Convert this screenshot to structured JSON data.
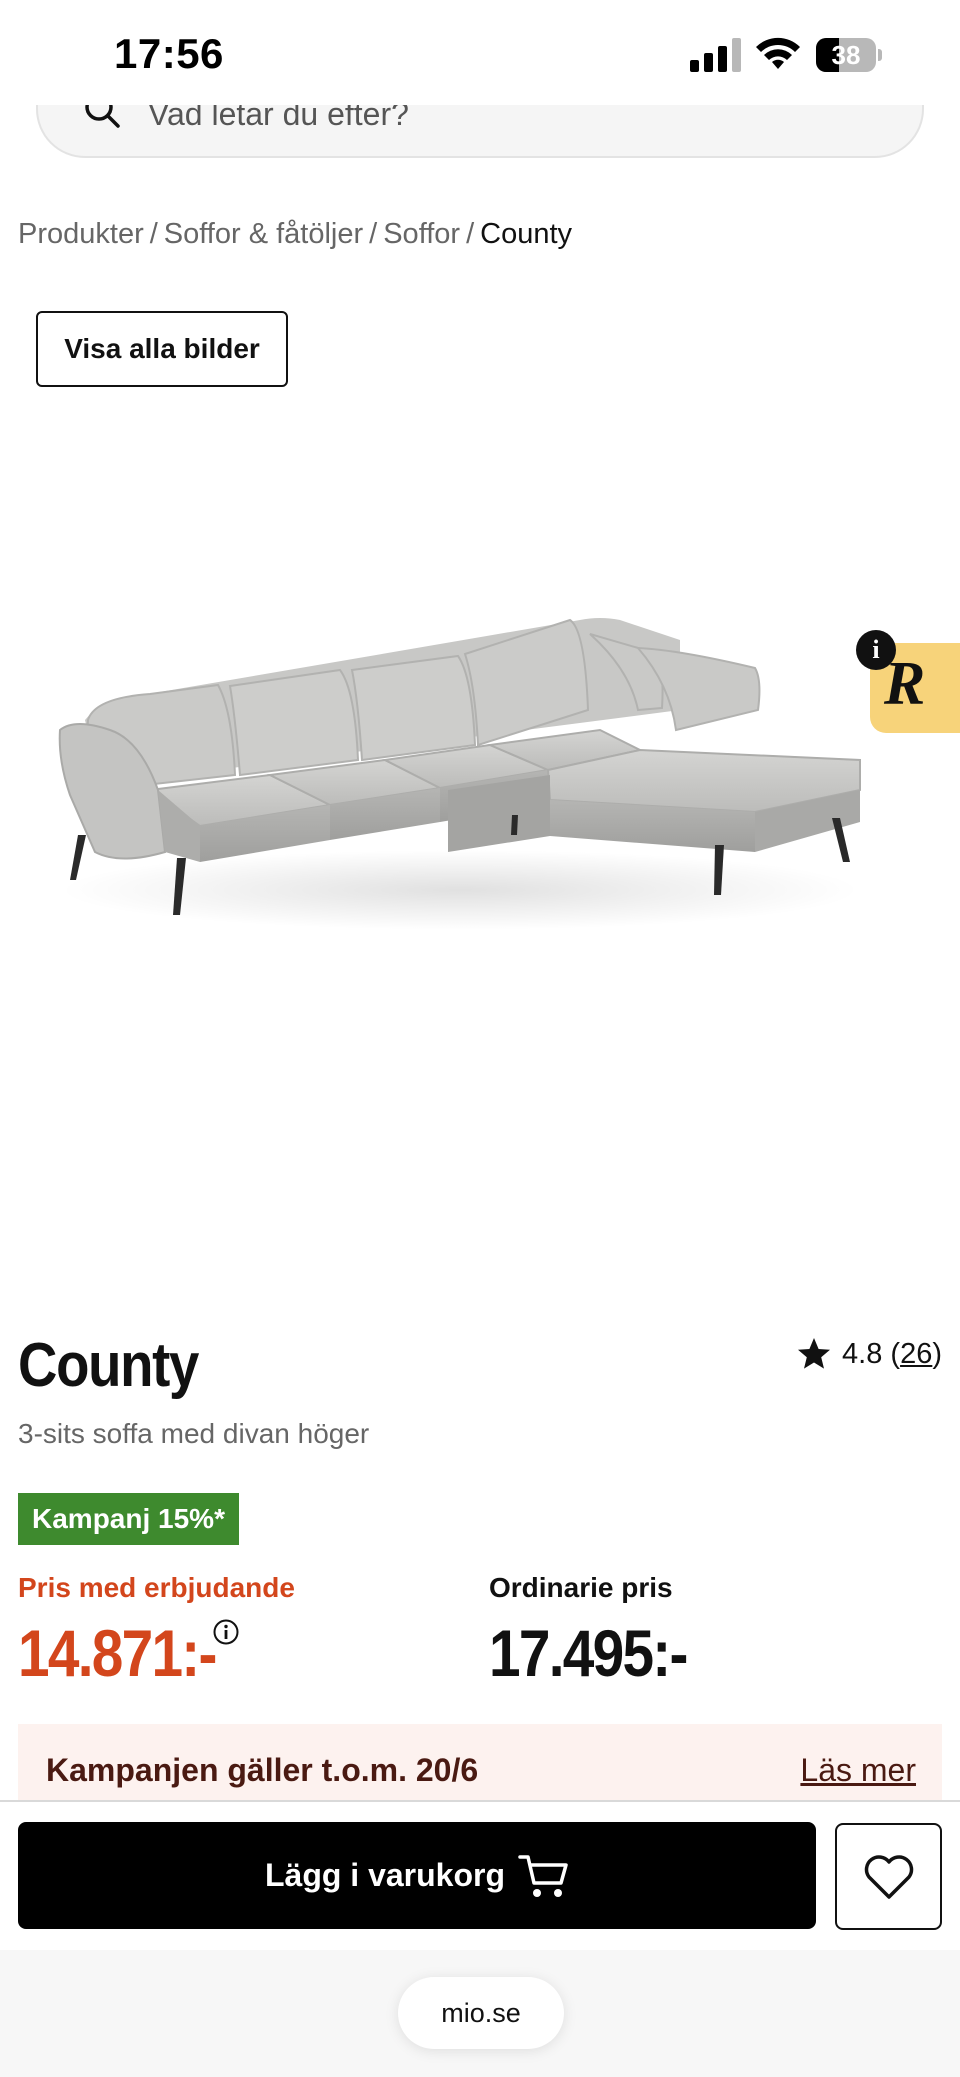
{
  "status_bar": {
    "time": "17:56",
    "battery_percent": 38,
    "battery_label": "38"
  },
  "search": {
    "placeholder": "Vad letar du efter?"
  },
  "breadcrumb": {
    "items": [
      "Produkter",
      "Soffor & fåtöljer",
      "Soffor"
    ],
    "separator": "/",
    "current": "County"
  },
  "gallery": {
    "show_all_label": "Visa alla bilder"
  },
  "widget": {
    "info_label": "i",
    "logo_letter": "R"
  },
  "product": {
    "name": "County",
    "subtitle": "3-sits soffa med divan höger",
    "rating": "4.8",
    "review_count": "26",
    "campaign_badge": "Kampanj 15%*",
    "offer_label": "Pris med erbjudande",
    "offer_price": "14.871:-",
    "regular_label": "Ordinarie pris",
    "regular_price": "17.495:-"
  },
  "campaign_banner": {
    "text": "Kampanjen gäller t.o.m. 20/6",
    "link": "Läs mer"
  },
  "actions": {
    "add_to_cart": "Lägg i varukorg"
  },
  "browser": {
    "url": "mio.se"
  },
  "colors": {
    "offer": "#d3461c",
    "campaign_badge": "#3e8a2e",
    "banner_bg": "#fdf2ef",
    "widget": "#f7d37a"
  }
}
